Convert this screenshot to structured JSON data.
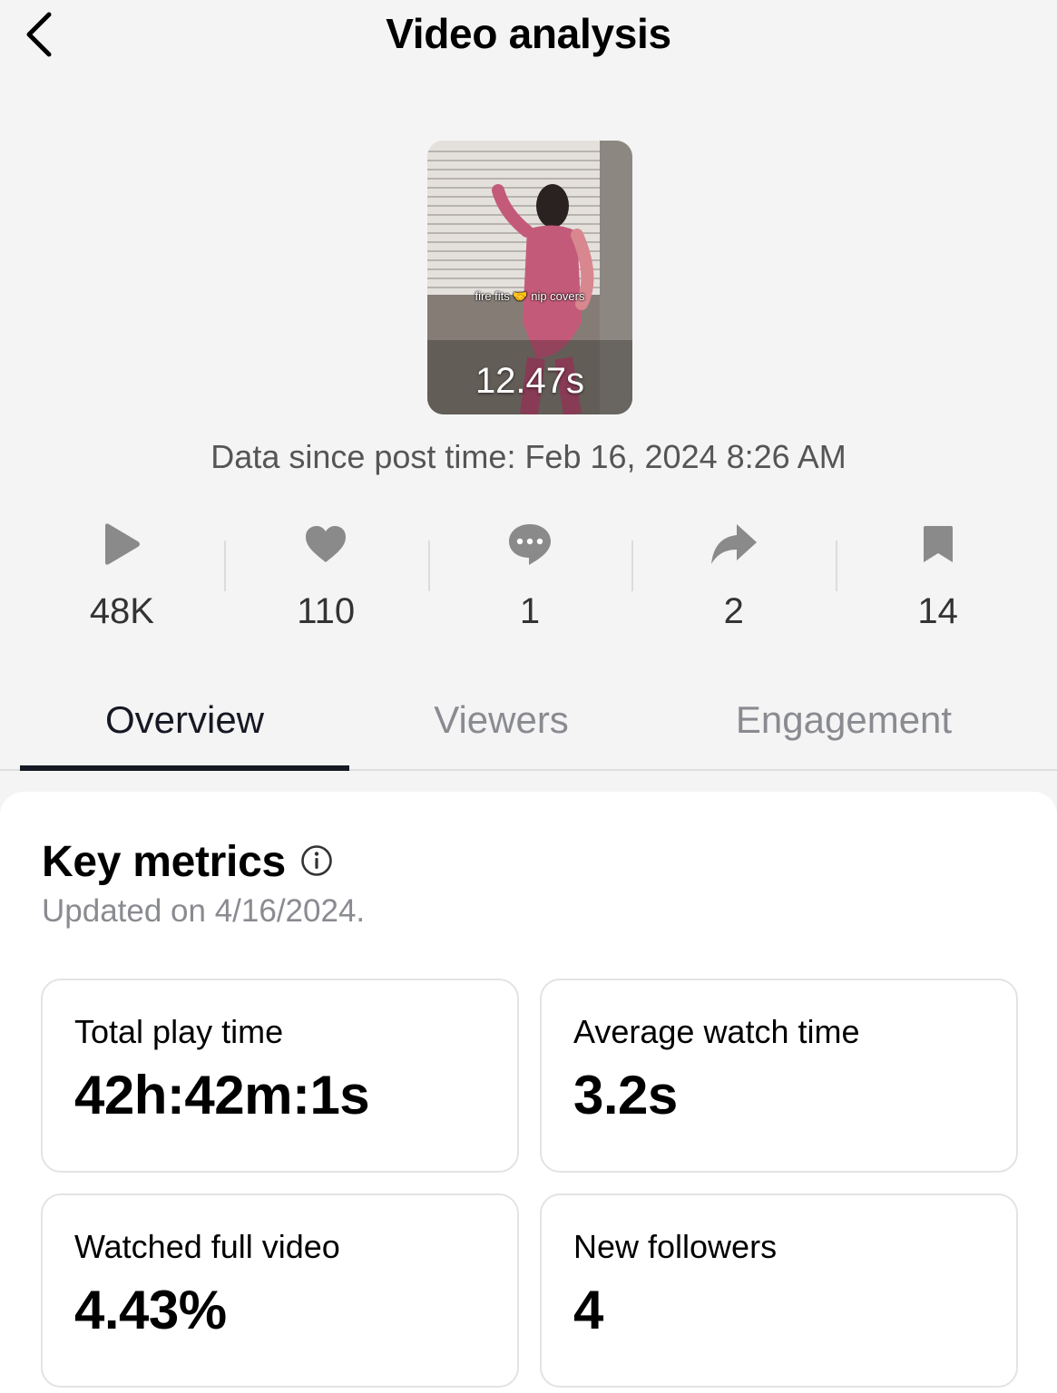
{
  "header": {
    "title": "Video analysis"
  },
  "video": {
    "caption": "fire fits 🤝 nip covers",
    "duration": "12.47s",
    "post_time": "Data since post time: Feb 16, 2024 8:26 AM"
  },
  "stats": [
    {
      "icon": "play-icon",
      "value": "48K"
    },
    {
      "icon": "heart-icon",
      "value": "110"
    },
    {
      "icon": "comment-icon",
      "value": "1"
    },
    {
      "icon": "share-icon",
      "value": "2"
    },
    {
      "icon": "bookmark-icon",
      "value": "14"
    }
  ],
  "tabs": [
    {
      "label": "Overview",
      "active": true
    },
    {
      "label": "Viewers",
      "active": false
    },
    {
      "label": "Engagement",
      "active": false
    }
  ],
  "key_metrics": {
    "title": "Key metrics",
    "updated": "Updated on 4/16/2024.",
    "cards": [
      {
        "label": "Total play time",
        "value": "42h:42m:1s"
      },
      {
        "label": "Average watch time",
        "value": "3.2s"
      },
      {
        "label": "Watched full video",
        "value": "4.43%"
      },
      {
        "label": "New followers",
        "value": "4"
      }
    ]
  },
  "colors": {
    "background": "#f4f4f4",
    "text": "#161823",
    "muted": "#8a8b91",
    "icon": "#8a8a8a"
  }
}
